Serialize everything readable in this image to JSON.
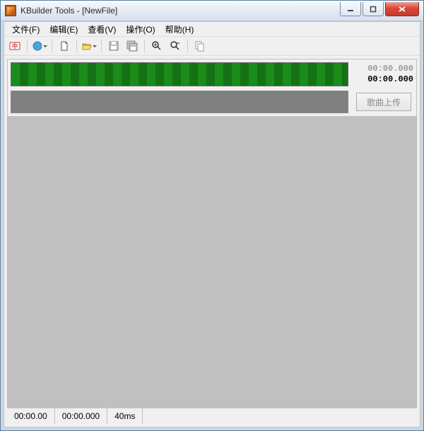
{
  "titlebar": {
    "title": "KBuilder Tools - [NewFile]"
  },
  "menu": {
    "file": "文件(F)",
    "edit": "编辑(E)",
    "view": "查看(V)",
    "op": "操作(O)",
    "help": "帮助(H)"
  },
  "toolbar": {
    "icons": {
      "lang": "lang-icon",
      "globe": "globe-icon",
      "newfile": "new-file-icon",
      "open": "open-folder-icon",
      "save": "save-icon",
      "saveall": "save-all-icon",
      "find": "find-icon",
      "findreplace": "find-replace-icon",
      "copy": "copy-icon"
    }
  },
  "times": {
    "t1": "00:00.000",
    "t2": "00:00.000"
  },
  "buttons": {
    "upload": "歌曲上传"
  },
  "status": {
    "a": "00:00.00",
    "b": "00:00.000",
    "c": "40ms"
  }
}
